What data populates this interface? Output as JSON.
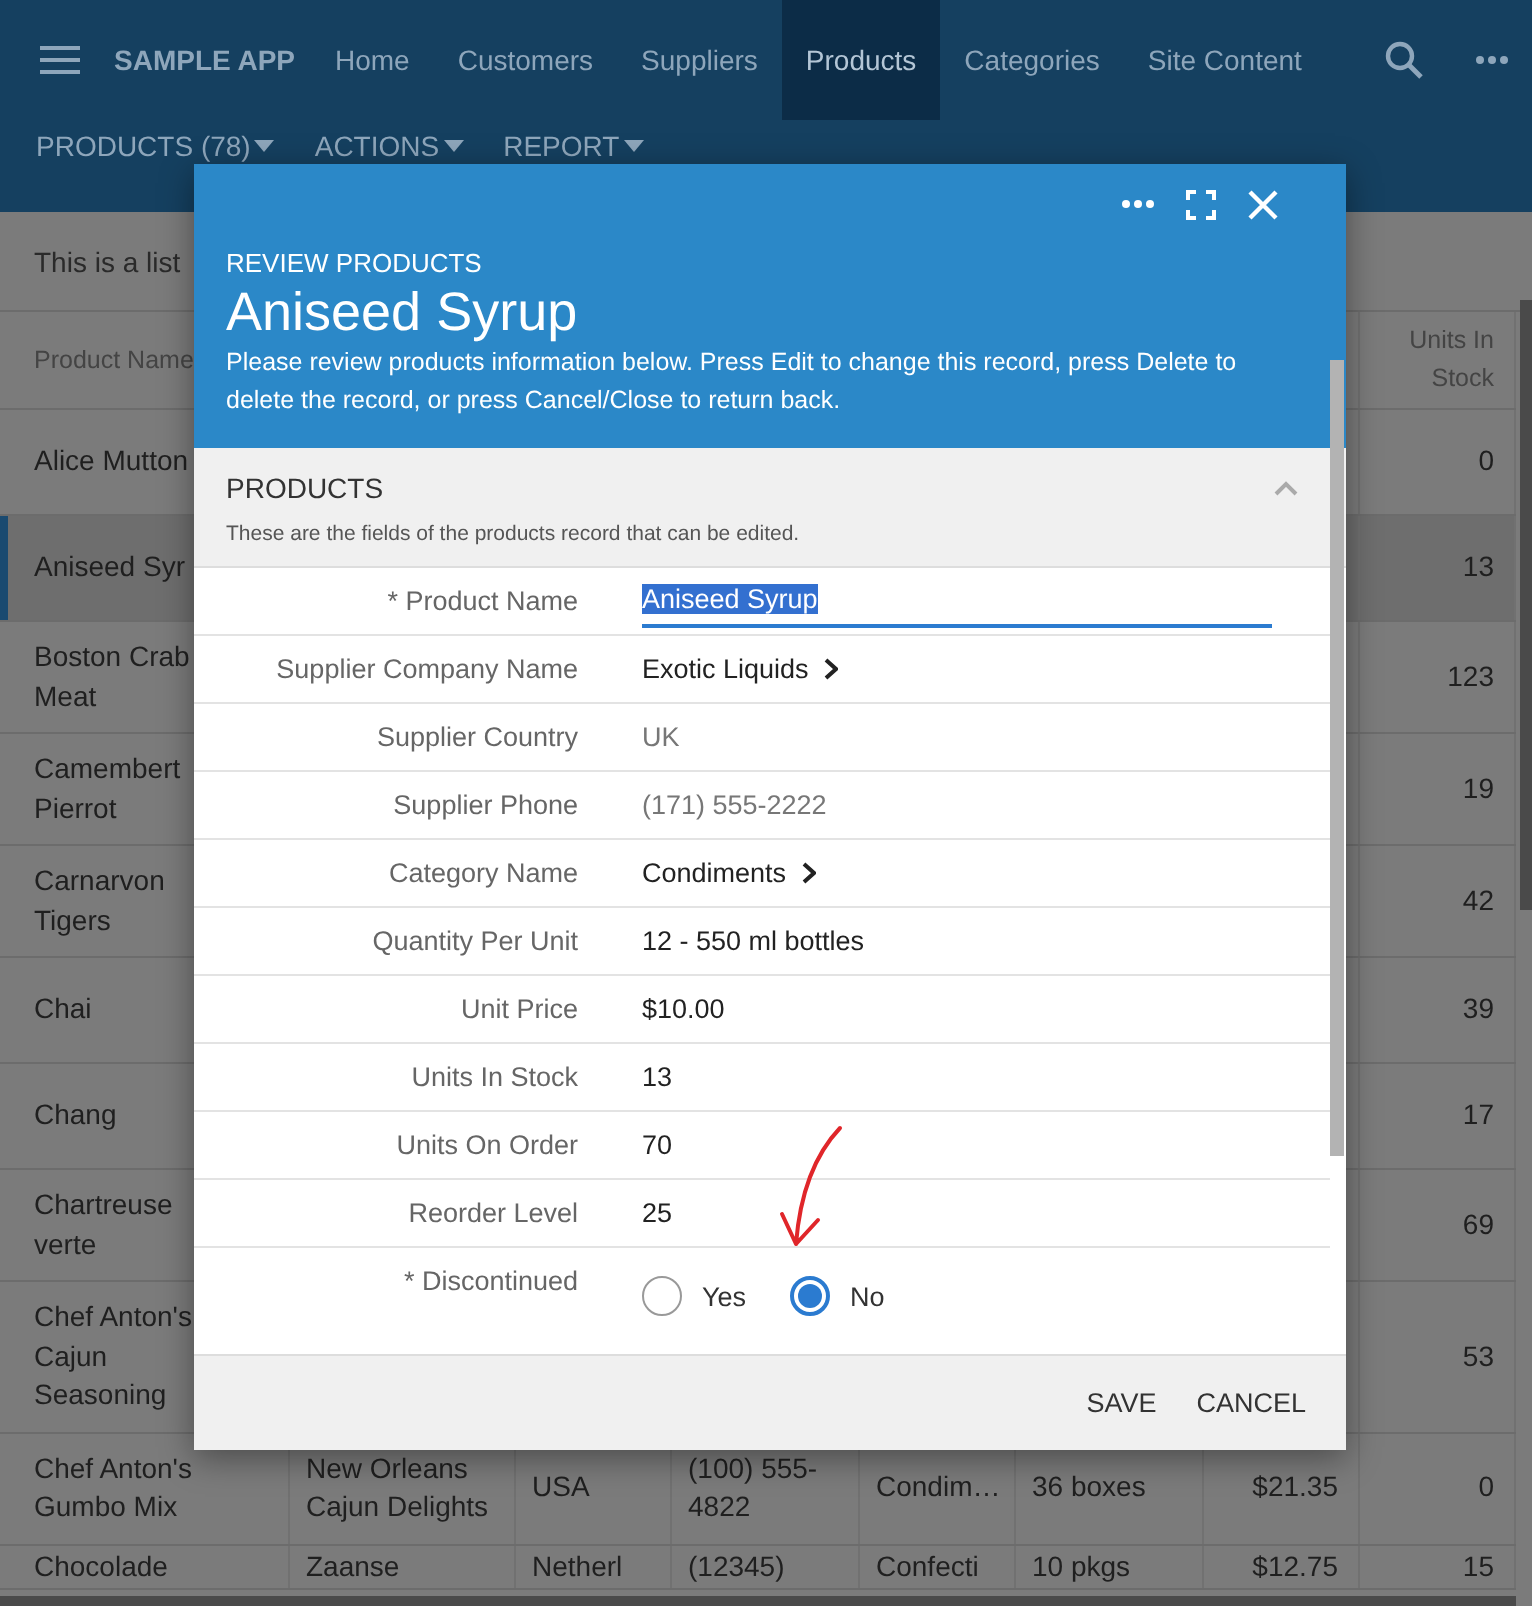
{
  "nav": {
    "brand": "SAMPLE APP",
    "items": [
      {
        "label": "Home",
        "selected": false
      },
      {
        "label": "Customers",
        "selected": false
      },
      {
        "label": "Suppliers",
        "selected": false
      },
      {
        "label": "Products",
        "selected": true
      },
      {
        "label": "Categories",
        "selected": false
      },
      {
        "label": "Site Content",
        "selected": false
      }
    ]
  },
  "toolbar": {
    "items": [
      "PRODUCTS (78)",
      "ACTIONS",
      "REPORT"
    ]
  },
  "intro": "This is a list",
  "table": {
    "header": {
      "name": "Product Name",
      "stock": "Units In Stock"
    },
    "rows": [
      {
        "name": "Alice Mutton",
        "stock": "0",
        "selected": false
      },
      {
        "name": "Aniseed Syr",
        "stock": "13",
        "selected": true
      },
      {
        "name": "Boston Crab Meat",
        "stock": "123",
        "selected": false
      },
      {
        "name": "Camembert Pierrot",
        "stock": "19",
        "selected": false
      },
      {
        "name": "Carnarvon Tigers",
        "stock": "42",
        "selected": false
      },
      {
        "name": "Chai",
        "stock": "39",
        "selected": false
      },
      {
        "name": "Chang",
        "stock": "17",
        "selected": false
      },
      {
        "name": "Chartreuse verte",
        "stock": "69",
        "selected": false
      },
      {
        "name": "Chef Anton's Cajun Seasoning",
        "stock": "53",
        "selected": false
      },
      {
        "name": "Chef Anton's Gumbo Mix",
        "supplier": "New Orleans Cajun Delights",
        "country": "USA",
        "phone": "(100) 555-4822",
        "category": "Condim…",
        "quantity": "36 boxes",
        "unit_price": "$21.35",
        "stock": "0",
        "selected": false
      },
      {
        "name": "Chocolade",
        "supplier": "Zaanse",
        "country": "Netherl",
        "phone": "(12345)",
        "category": "Confecti",
        "quantity": "10 pkgs",
        "unit_price": "$12.75",
        "stock": "15",
        "selected": false
      }
    ]
  },
  "modal": {
    "overline": "REVIEW PRODUCTS",
    "title": "Aniseed Syrup",
    "description": "Please review products information below. Press Edit to change this record, press Delete to delete the record, or press Cancel/Close to return back.",
    "section": {
      "title": "PRODUCTS",
      "expanded": true,
      "hint": "These are the fields of the products record that can be edited."
    },
    "fields": [
      {
        "kind": "input",
        "label": "* Product Name",
        "value": "Aniseed Syrup"
      },
      {
        "kind": "link",
        "label": "Supplier Company Name",
        "value": "Exotic Liquids"
      },
      {
        "kind": "readonly",
        "label": "Supplier Country",
        "value": "UK"
      },
      {
        "kind": "readonly",
        "label": "Supplier Phone",
        "value": "(171) 555-2222"
      },
      {
        "kind": "link",
        "label": "Category Name",
        "value": "Condiments"
      },
      {
        "kind": "text",
        "label": "Quantity Per Unit",
        "value": "12 - 550 ml bottles"
      },
      {
        "kind": "text",
        "label": "Unit Price",
        "value": "$10.00"
      },
      {
        "kind": "text",
        "label": "Units In Stock",
        "value": "13"
      },
      {
        "kind": "text",
        "label": "Units On Order",
        "value": "70"
      },
      {
        "kind": "text",
        "label": "Reorder Level",
        "value": "25"
      },
      {
        "kind": "radio",
        "label": "* Discontinued",
        "options": [
          {
            "label": "Yes",
            "selected": false
          },
          {
            "label": "No",
            "selected": true
          }
        ]
      }
    ],
    "buttons": [
      "SAVE",
      "CANCEL"
    ]
  }
}
